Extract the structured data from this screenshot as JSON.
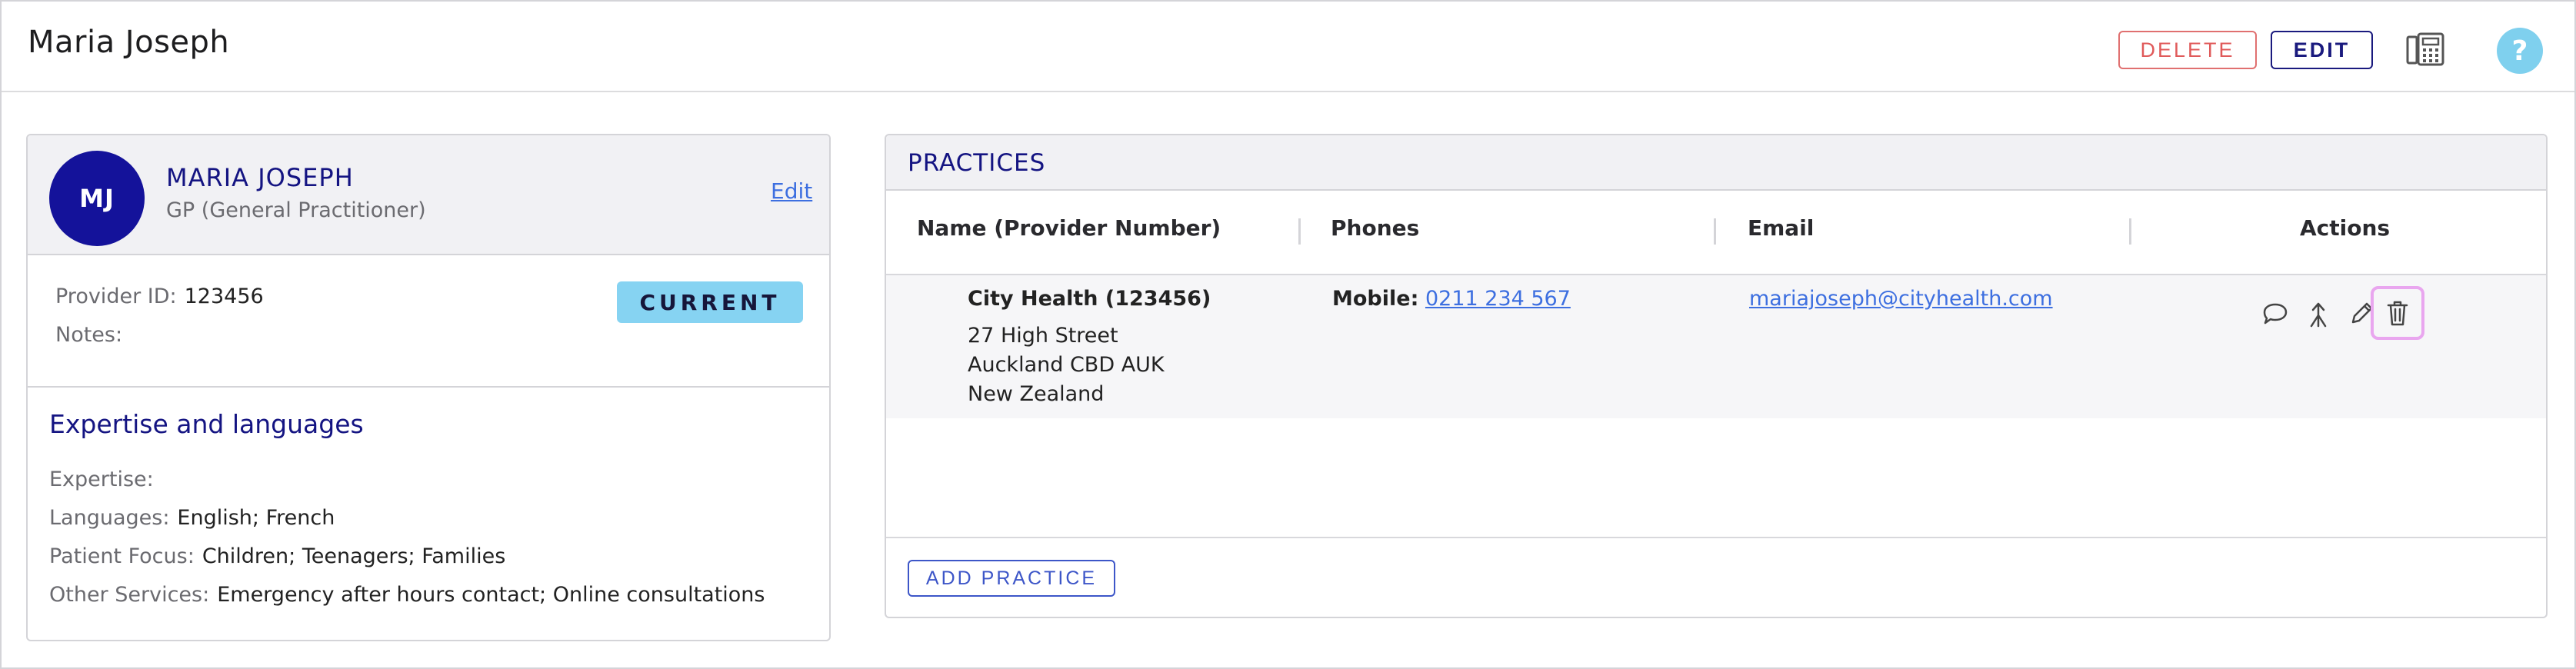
{
  "header": {
    "title": "Maria Joseph",
    "delete_label": "DELETE",
    "edit_label": "EDIT",
    "phonebook_icon": "phonebook-icon",
    "help_label": "?"
  },
  "provider": {
    "initials": "MJ",
    "name": "MARIA JOSEPH",
    "role": "GP (General Practitioner)",
    "edit_link": "Edit",
    "provider_id_label": "Provider ID:",
    "provider_id_value": "123456",
    "notes_label": "Notes:",
    "notes_value": "",
    "status_badge": "CURRENT",
    "avatar_color": "#14129a",
    "badge_color": "#86d3f2"
  },
  "expertise": {
    "title": "Expertise and languages",
    "rows": [
      {
        "label": "Expertise:",
        "value": ""
      },
      {
        "label": "Languages:",
        "value": "English; French"
      },
      {
        "label": "Patient Focus:",
        "value": "Children; Teenagers; Families"
      },
      {
        "label": "Other Services:",
        "value": "Emergency after hours contact; Online consultations"
      }
    ]
  },
  "practices": {
    "title": "PRACTICES",
    "columns": [
      "Name (Provider Number)",
      "Phones",
      "Email",
      "Actions"
    ],
    "rows": [
      {
        "name": "City Health (123456)",
        "address_line1": "27 High Street",
        "address_line2": "Auckland CBD AUK",
        "address_line3": "New Zealand",
        "phone_label": "Mobile:",
        "phone_value": "0211 234 567",
        "email": "mariajoseph@cityhealth.com",
        "actions": [
          "chat-icon",
          "merge-icon",
          "pencil-icon",
          "trash-icon"
        ]
      }
    ],
    "add_label": "ADD PRACTICE"
  }
}
